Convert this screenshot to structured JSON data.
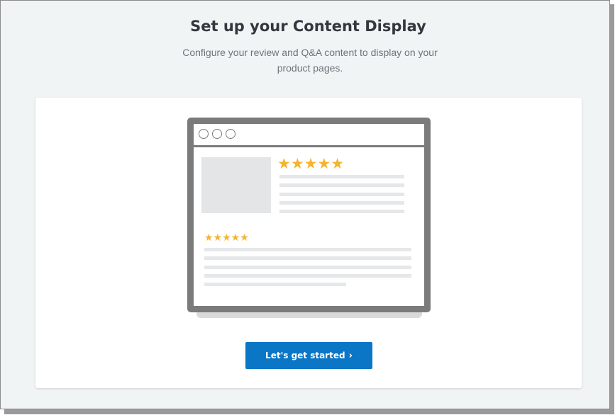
{
  "header": {
    "title": "Set up your Content Display",
    "subtitle": "Configure your review and Q&A content to display on your product pages."
  },
  "illustration": {
    "top_review_stars": "★★★★★",
    "bottom_review_stars": "★★★★★",
    "star_color": "#f5b42d",
    "frame_color": "#7b7b7b"
  },
  "cta": {
    "label": "Let's get started",
    "icon": "chevron-right-icon",
    "background": "#0b76c5"
  }
}
